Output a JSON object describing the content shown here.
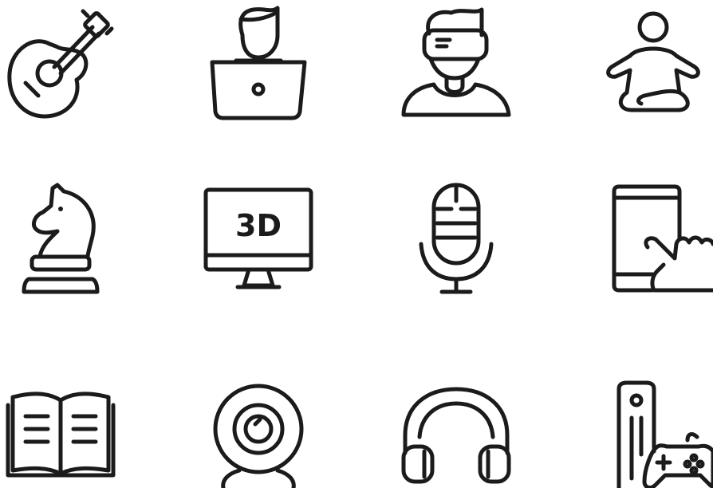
{
  "colors": {
    "stroke": "#1b1b1b",
    "background": "#ffffff"
  },
  "icons": [
    {
      "name": "guitar-icon"
    },
    {
      "name": "person-laptop-icon"
    },
    {
      "name": "vr-headset-user-icon"
    },
    {
      "name": "meditation-icon"
    },
    {
      "name": "chess-knight-icon"
    },
    {
      "name": "monitor-3d-icon",
      "label": "3D"
    },
    {
      "name": "microphone-icon"
    },
    {
      "name": "phone-touch-icon"
    },
    {
      "name": "open-book-icon"
    },
    {
      "name": "webcam-icon"
    },
    {
      "name": "headphones-icon"
    },
    {
      "name": "pc-gamepad-icon"
    }
  ]
}
